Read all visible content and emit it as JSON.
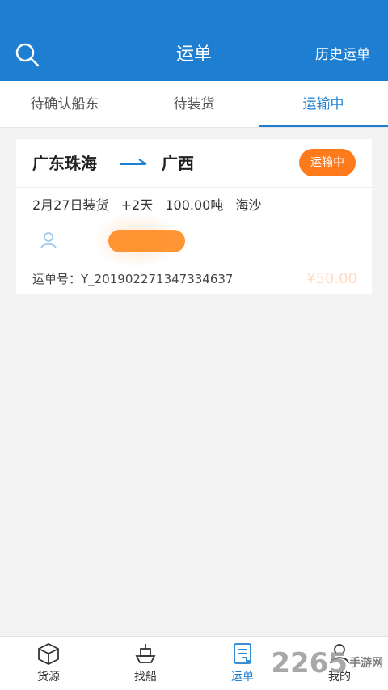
{
  "header": {
    "title": "运单",
    "history_label": "历史运单",
    "search_icon": "search-icon"
  },
  "tabs": [
    {
      "label": "待确认船东",
      "active": false
    },
    {
      "label": "待装货",
      "active": false
    },
    {
      "label": "运输中",
      "active": true
    }
  ],
  "card": {
    "from": "广东珠海",
    "to": "广西",
    "status": "运输中",
    "load_date": "2月27日装货",
    "duration": "+2天",
    "weight": "100.00吨",
    "cargo": "海沙",
    "order_label": "运单号：",
    "order_number": "Y_20190227134733463​7",
    "price": "¥50.00"
  },
  "bottom_nav": [
    {
      "label": "货源",
      "icon": "box-icon",
      "active": false
    },
    {
      "label": "找船",
      "icon": "ship-icon",
      "active": false
    },
    {
      "label": "运单",
      "icon": "waybill-icon",
      "active": true
    },
    {
      "label": "我的",
      "icon": "profile-icon",
      "active": false
    }
  ],
  "watermark": {
    "text": "2265",
    "sub": "手游网"
  },
  "colors": {
    "primary": "#1e7fd2",
    "accent": "#ff7a1a"
  }
}
